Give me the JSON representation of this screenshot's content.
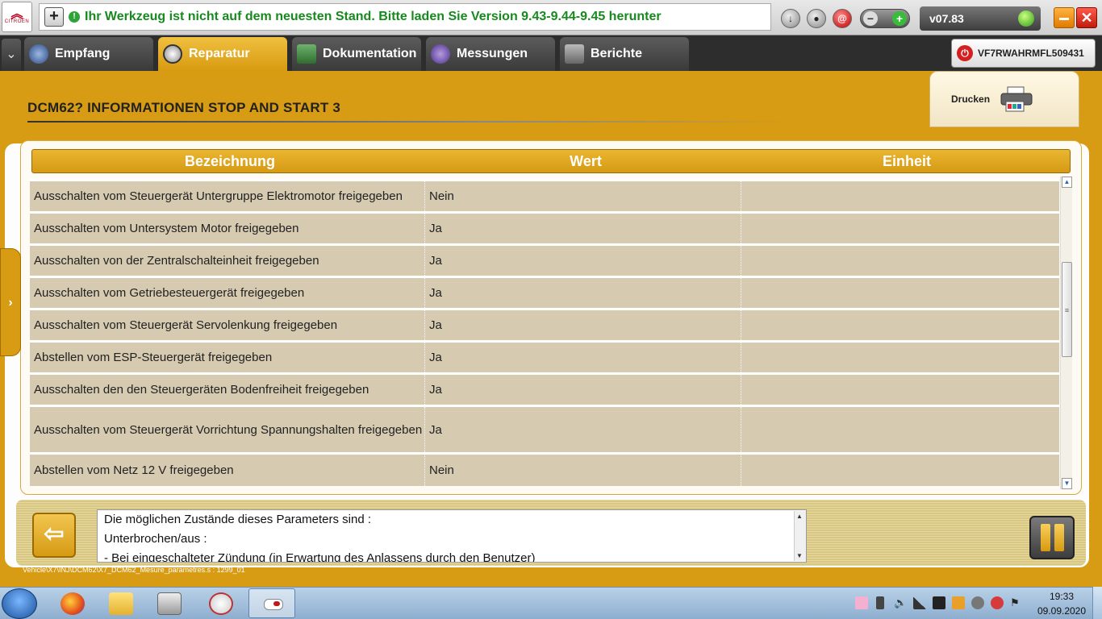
{
  "topbar": {
    "logo_text": "CITROËN",
    "notice": "Ihr Werkzeug ist nicht auf dem neuesten Stand. Bitte laden Sie Version 9.43-9.44-9.45 herunter",
    "version": "v07.83"
  },
  "nav": {
    "tabs": [
      {
        "label": "Empfang"
      },
      {
        "label": "Reparatur"
      },
      {
        "label": "Dokumentation"
      },
      {
        "label": "Messungen"
      },
      {
        "label": "Berichte"
      }
    ],
    "active_tab": "Reparatur",
    "vin": "VF7RWAHRMFL509431"
  },
  "page": {
    "title": "DCM62?  INFORMATIONEN STOP AND START 3",
    "print_label": "Drucken"
  },
  "table": {
    "columns": [
      "Bezeichnung",
      "Wert",
      "Einheit"
    ],
    "rows": [
      {
        "name": "Ausschalten vom Steuergerät Untergruppe Elektromotor freigegeben",
        "value": "Nein",
        "unit": ""
      },
      {
        "name": "Ausschalten vom Untersystem Motor freigegeben",
        "value": "Ja",
        "unit": ""
      },
      {
        "name": "Ausschalten von der Zentralschalteinheit freigegeben",
        "value": "Ja",
        "unit": ""
      },
      {
        "name": "Ausschalten vom Getriebesteuergerät freigegeben",
        "value": "Ja",
        "unit": ""
      },
      {
        "name": "Ausschalten vom Steuergerät Servolenkung freigegeben",
        "value": "Ja",
        "unit": ""
      },
      {
        "name": "Abstellen vom ESP-Steuergerät freigegeben",
        "value": "Ja",
        "unit": ""
      },
      {
        "name": "Ausschalten den den Steuergeräten Bodenfreiheit freigegeben",
        "value": "Ja",
        "unit": ""
      },
      {
        "name": "Ausschalten vom Steuergerät Vorrichtung Spannungshalten freigegeben",
        "value": "Ja",
        "unit": ""
      },
      {
        "name": "Abstellen vom Netz 12 V freigegeben",
        "value": "Nein",
        "unit": ""
      }
    ]
  },
  "info": {
    "lines": [
      "Die möglichen Zustände dieses Parameters sind :",
      "Unterbrochen/aus :",
      "- Bei eingeschalteter Zündung (in Erwartung des Anlassens durch den Benutzer)"
    ]
  },
  "footer": {
    "path": "Vehicle\\X7\\INJ\\DCM62\\X7_DCM62_Mesure_parametres.s : 1299_01"
  },
  "taskbar": {
    "time": "19:33",
    "date": "09.09.2020"
  },
  "colors": {
    "accent": "#d79b14",
    "row_bg": "#d6cab0",
    "notice_green": "#178a1e"
  }
}
